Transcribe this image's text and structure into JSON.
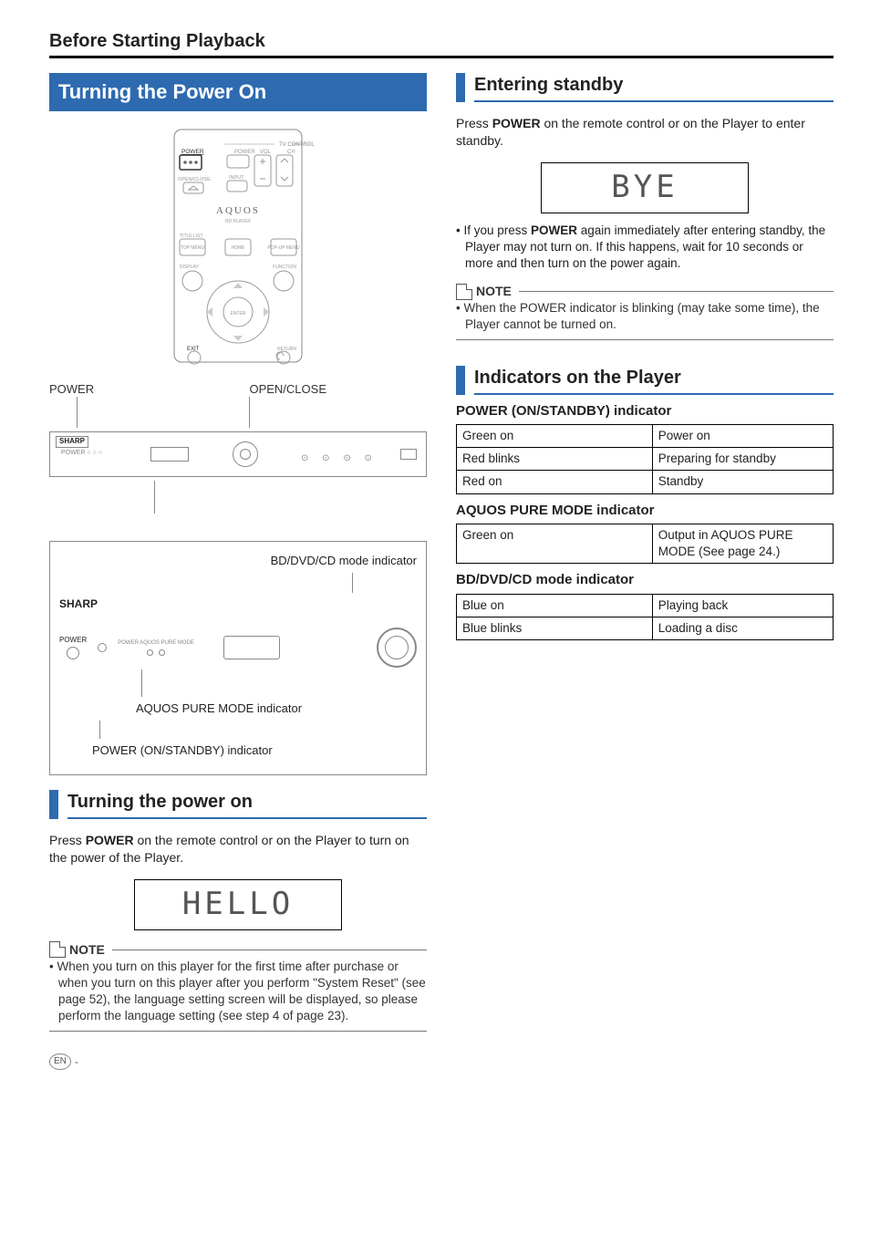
{
  "section_title": "Before Starting Playback",
  "left": {
    "main_bar": "Turning the Power On",
    "remote": {
      "tv_control": "TV CONTROL",
      "power": "POWER",
      "power2": "POWER",
      "vol": "VOL",
      "ch": "CH",
      "open_close": "OPEN/CLOSE",
      "input": "INPUT",
      "aquos": "AQUOS",
      "bd_player": "BD PLAYER",
      "title_list": "TITLE LIST",
      "top_menu": "TOP MENU",
      "home": "HOME",
      "popup_menu": "POP-UP MENU",
      "display": "DISPLAY",
      "function_": "FUNCTION",
      "enter": "ENTER",
      "exit": "EXIT",
      "return_": "RETURN"
    },
    "callouts": {
      "power": "POWER",
      "open_close": "OPEN/CLOSE",
      "sharp": "SHARP",
      "bd_mode": "BD/DVD/CD mode indicator",
      "aquos_pure": "AQUOS PURE MODE indicator",
      "power_ind": "POWER (ON/STANDBY) indicator"
    },
    "turning_on_bar": "Turning the power on",
    "turning_on_body_pre": "Press ",
    "turning_on_body_strong": "POWER",
    "turning_on_body_post": " on the remote control or on the Player to turn on the power of the Player.",
    "hello": "HELLO",
    "note_label": "NOTE",
    "note1": "•  When you turn on this player for the first time after purchase or when you turn on this player after you perform \"System Reset\" (see page 52), the language setting screen will be displayed, so please perform the language setting (see step 4 of page 23)."
  },
  "right": {
    "standby_bar": "Entering standby",
    "standby_pre": "Press ",
    "standby_strong": "POWER",
    "standby_post": " on the remote control or on the Player to enter standby.",
    "bye": "BYE",
    "bullet_pre": "•  If you press ",
    "bullet_strong": "POWER",
    "bullet_post": " again immediately after entering standby, the Player may not turn on. If this happens, wait for 10 seconds or more and then turn on the power again.",
    "note_label": "NOTE",
    "note1": "•  When the POWER indicator is blinking (may take some time), the Player cannot be turned on.",
    "indicators_bar": "Indicators on the Player",
    "power_ind_head": "POWER (ON/STANDBY) indicator",
    "power_table": [
      [
        "Green on",
        "Power on"
      ],
      [
        "Red blinks",
        "Preparing for standby"
      ],
      [
        "Red on",
        "Standby"
      ]
    ],
    "aquos_ind_head": "AQUOS PURE MODE indicator",
    "aquos_table": [
      [
        "Green on",
        "Output in AQUOS PURE MODE (See page 24.)"
      ]
    ],
    "bd_ind_head": "BD/DVD/CD mode indicator",
    "bd_table": [
      [
        "Blue on",
        "Playing back"
      ],
      [
        "Blue blinks",
        "Loading a disc"
      ]
    ]
  },
  "footer": {
    "en": "EN",
    "dash": "-"
  }
}
